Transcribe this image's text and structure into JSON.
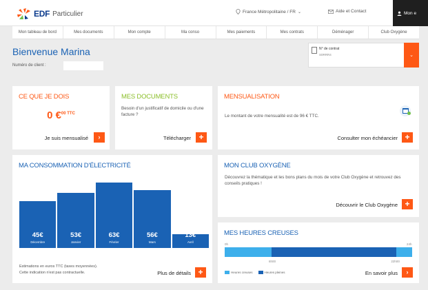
{
  "header": {
    "logo_brand": "EDF",
    "logo_product": "Particulier",
    "region": "France Métropolitaine / FR",
    "help": "Aide et Contact",
    "account": "Mon e"
  },
  "nav": {
    "items": [
      "Mon tableau de bord",
      "Mes documents",
      "Mon compte",
      "Ma conso",
      "Mes paiements",
      "Mes contrats",
      "Déménager",
      "Club Oxygène"
    ]
  },
  "welcome": {
    "greeting": "Bienvenue Marina",
    "client_label": "Numéro de client :"
  },
  "contract": {
    "label": "N° de contrat",
    "number": "S0RRR4"
  },
  "owe_card": {
    "title": "CE QUE JE DOIS",
    "amount": "0 €",
    "amount_suffix": "00 TTC",
    "action": "Je suis mensualisé"
  },
  "docs_card": {
    "title": "MES DOCUMENTS",
    "text": "Besoin d'un justificatif de domicile ou d'une facture ?",
    "action": "Télécharger"
  },
  "mensualisation_card": {
    "title": "MENSUALISATION",
    "text": "Le montant de votre mensualité est de 96 € TTC.",
    "action": "Consulter mon échéancier"
  },
  "conso_card": {
    "title": "MA CONSOMMATION D'ÉLECTRICITÉ",
    "note_line1": "Estimations en euros TTC (taxes moyennées).",
    "note_line2": "Cette indication n'est pas contractuelle.",
    "action": "Plus de détails"
  },
  "chart_data": {
    "type": "bar",
    "categories": [
      "Décembre",
      "Janvier",
      "Février",
      "Mars",
      "Avril"
    ],
    "values": [
      45,
      53,
      63,
      56,
      13
    ],
    "value_labels": [
      "45€",
      "53€",
      "63€",
      "56€",
      "13€"
    ],
    "ylim": [
      0,
      70
    ]
  },
  "club_card": {
    "title": "MON CLUB OXYGÈNE",
    "text": "Découvrez la thématique et les bons plans du mois de votre Club Oxygène et retrouvez des conseils pratiques !",
    "action": "Découvrir le Club Oxygène"
  },
  "hc_card": {
    "title": "MES HEURES CREUSES",
    "tick_start": "0h",
    "tick_end": "24h",
    "tick_a": "6h00",
    "tick_b": "22h00",
    "legend_creuses": "Heures creuses",
    "legend_pleines": "Heures pleines",
    "action": "En savoir plus",
    "pleines_start_h": 6,
    "pleines_end_h": 22
  },
  "colors": {
    "accent": "#fe5815",
    "brand_blue": "#1a62b4",
    "light_blue": "#3dafeb",
    "green": "#6fbf4b"
  }
}
